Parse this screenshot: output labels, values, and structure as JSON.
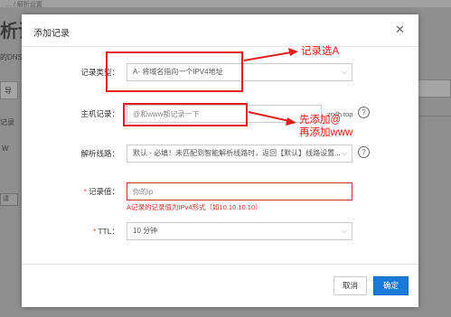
{
  "background": {
    "breadcrumb": "… / 解析设置",
    "page_title": "析设",
    "subtitle": "的DNS",
    "import_btn": "导",
    "records_label": "记录",
    "column_hint": "W",
    "search_box": "请"
  },
  "modal": {
    "title": "添加记录",
    "close_icon": "close-icon",
    "record_type": {
      "label": "记录类型",
      "value": "A- 将域名指向一个IPV4地址"
    },
    "host_record": {
      "label": "主机记录",
      "placeholder": "@和www都记录一下",
      "suffix": ".zrxlh.top",
      "help_icon": "question-circle-icon"
    },
    "resolve_line": {
      "label": "解析线路",
      "value": "默认 - 必填！未匹配到智能解析线路时，返回【默认】线路设置...",
      "help_icon": "question-circle-icon"
    },
    "record_value": {
      "label": "记录值",
      "placeholder": "你的ip",
      "hint": "A记录的记录值为IPv4形式（如10.10.10.10）"
    },
    "ttl": {
      "label": "TTL",
      "value": "10 分钟"
    },
    "cancel_label": "取消",
    "ok_label": "确定"
  },
  "annotations": {
    "note_type": "记录选A",
    "note_host_line1": "先添加@",
    "note_host_line2": "再添加www"
  },
  "colors": {
    "accent": "#1a7ad9",
    "annotation": "#e02020",
    "error": "#c9302c"
  }
}
